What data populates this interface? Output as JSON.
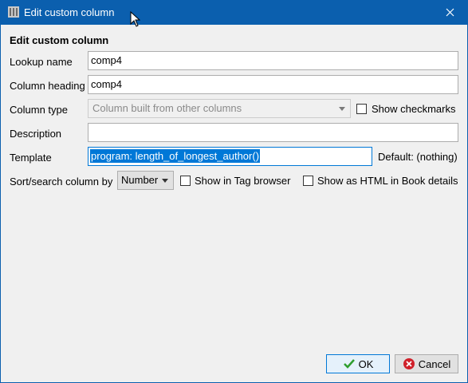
{
  "window": {
    "title": "Edit custom column",
    "app_icon": "calibre-icon",
    "close_icon": "close-icon"
  },
  "form": {
    "heading": "Edit custom column",
    "lookup_name": {
      "label": "Lookup name",
      "value": "comp4"
    },
    "column_heading": {
      "label": "Column heading",
      "value": "comp4"
    },
    "column_type": {
      "label": "Column type",
      "value": "Column built from other columns",
      "checkmarks_label": "Show checkmarks"
    },
    "description": {
      "label": "Description",
      "value": ""
    },
    "template": {
      "label": "Template",
      "value": "program: length_of_longest_author()",
      "default_text": "Default: (nothing)"
    },
    "sort": {
      "label": "Sort/search column by",
      "value": "Number",
      "tag_browser_label": "Show in Tag browser",
      "html_label": "Show as HTML in Book details"
    }
  },
  "buttons": {
    "ok": "OK",
    "cancel": "Cancel"
  },
  "colors": {
    "titlebar": "#0b5fae",
    "accent": "#0078d7",
    "ok_icon": "#2e9e2e",
    "cancel_icon": "#d0202a"
  }
}
